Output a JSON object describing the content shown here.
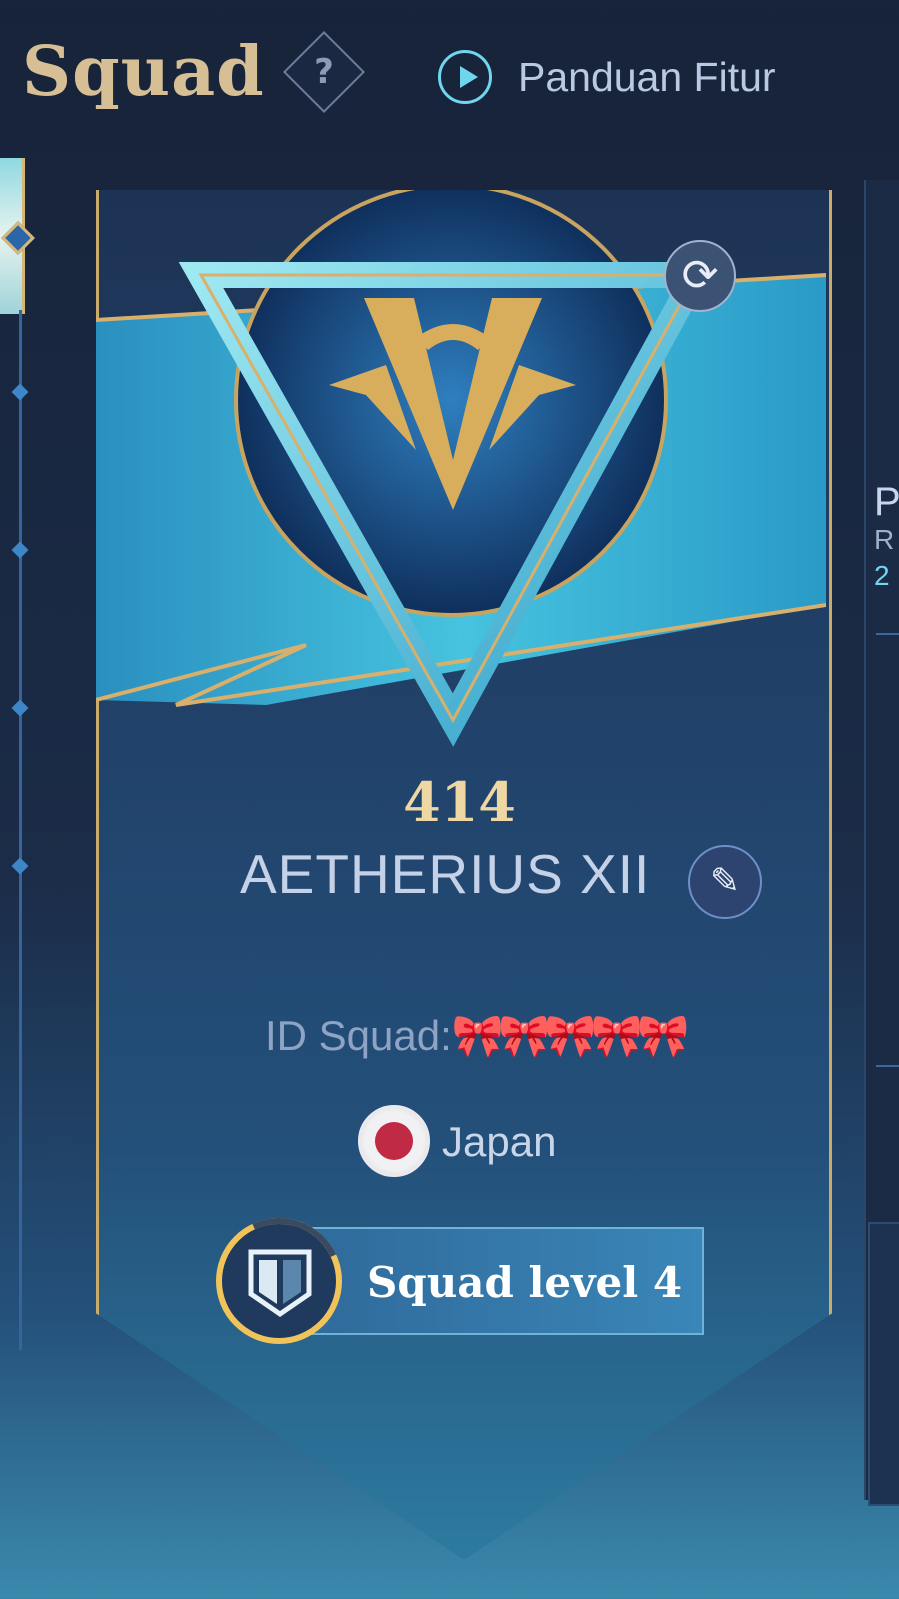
{
  "header": {
    "title": "Squad",
    "help_icon": "?",
    "guide_label": "Panduan Fitur"
  },
  "squad": {
    "score": "414",
    "name": "AETHERIUS XII",
    "id_label": "ID Squad:",
    "id_masked": "🎀🎀🎀🎀🎀",
    "country": "Japan",
    "level_label": "Squad level 4"
  },
  "right_card": {
    "p": "P",
    "r": "R",
    "num": "2"
  },
  "icons": {
    "refresh": "⟳",
    "edit": "✎"
  },
  "colors": {
    "accent_gold": "#d7bf95",
    "accent_cyan": "#6fd6ee",
    "flag_red": "#c02a44",
    "level_ring": "#f0c45a"
  }
}
